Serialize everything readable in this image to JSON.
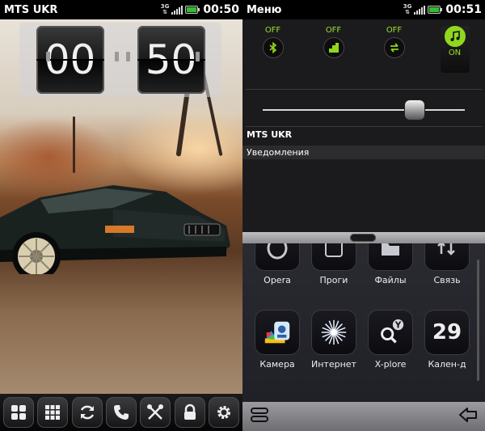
{
  "left": {
    "status": {
      "operator": "MTS UKR",
      "network": "3G",
      "time": "00:50"
    },
    "clock": {
      "hours": "00",
      "minutes": "50"
    },
    "dock": [
      "apps-grid-icon",
      "menu-grid-icon",
      "sync-icon",
      "phone-icon",
      "tools-icon",
      "lock-icon",
      "settings-icon"
    ]
  },
  "right": {
    "status": {
      "title": "Меню",
      "network": "3G",
      "time": "00:51"
    },
    "toggles": [
      {
        "icon": "bluetooth-icon",
        "state": "OFF"
      },
      {
        "icon": "data-icon",
        "state": "OFF"
      },
      {
        "icon": "transfer-icon",
        "state": "OFF"
      },
      {
        "icon": "music-note-icon",
        "state": "ON"
      }
    ],
    "brightness": 0.75,
    "notifications": {
      "operator": "MTS UKR",
      "header": "Уведомления"
    },
    "apps": [
      {
        "label": "Opera",
        "icon": "opera-icon"
      },
      {
        "label": "Проги",
        "icon": "apps-icon"
      },
      {
        "label": "Файлы",
        "icon": "files-icon"
      },
      {
        "label": "Связь",
        "icon": "connectivity-icon"
      },
      {
        "label": "Камера",
        "icon": "camera-icon"
      },
      {
        "label": "Интернет",
        "icon": "internet-icon"
      },
      {
        "label": "X-plore",
        "icon": "xplore-icon"
      },
      {
        "label": "Кален-д",
        "icon": "calendar-icon",
        "day": "29"
      }
    ]
  },
  "colors": {
    "accent": "#8fd81e",
    "battery": "#2fbf2f"
  }
}
